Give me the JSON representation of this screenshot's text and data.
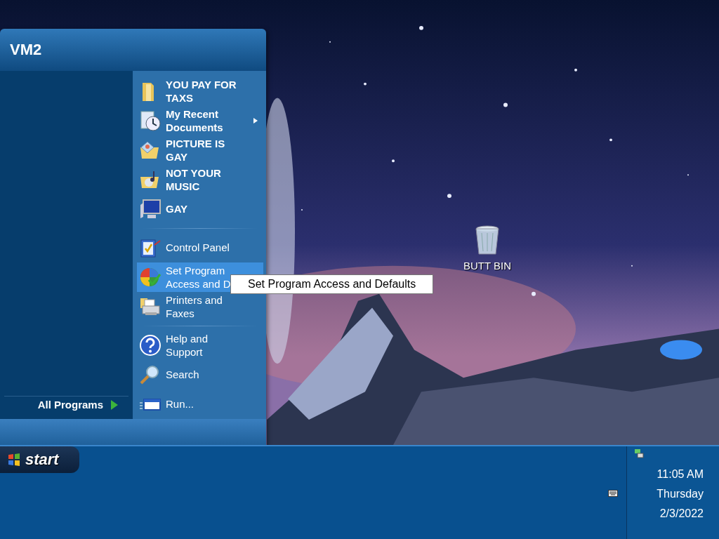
{
  "start_menu": {
    "user_name": "VM2",
    "items": [
      [
        {
          "label": "YOU PAY FOR TAXS",
          "kind": "folder",
          "bold": true,
          "submenu": false,
          "selected": false
        },
        {
          "label": "My Recent Documents",
          "kind": "recent",
          "bold": true,
          "submenu": true,
          "selected": false
        },
        {
          "label": "PICTURE IS GAY",
          "kind": "pictures",
          "bold": true,
          "submenu": false,
          "selected": false
        },
        {
          "label": "NOT YOUR MUSIC",
          "kind": "music",
          "bold": true,
          "submenu": false,
          "selected": false
        },
        {
          "label": "GAY",
          "kind": "computer",
          "bold": true,
          "submenu": false,
          "selected": false
        }
      ],
      [
        {
          "label": "Control Panel",
          "kind": "control",
          "bold": false,
          "submenu": false,
          "selected": false
        },
        {
          "label": "Set Program Access and D",
          "kind": "defaults",
          "bold": false,
          "submenu": false,
          "selected": true
        },
        {
          "label": "Printers and Faxes",
          "kind": "printers",
          "bold": false,
          "submenu": false,
          "selected": false
        }
      ],
      [
        {
          "label": "Help and Support",
          "kind": "help",
          "bold": false,
          "submenu": false,
          "selected": false
        },
        {
          "label": "Search",
          "kind": "search",
          "bold": false,
          "submenu": false,
          "selected": false
        },
        {
          "label": "Run...",
          "kind": "run",
          "bold": false,
          "submenu": false,
          "selected": false
        }
      ]
    ],
    "all_programs": "All Programs"
  },
  "tooltip": "Set Program Access and Defaults",
  "desktop_icons": [
    {
      "label": "BUTT BIN",
      "kind": "recycle"
    }
  ],
  "taskbar": {
    "start_label": "start",
    "clock": {
      "time": "11:05 AM",
      "day": "Thursday",
      "date": "2/3/2022"
    }
  }
}
